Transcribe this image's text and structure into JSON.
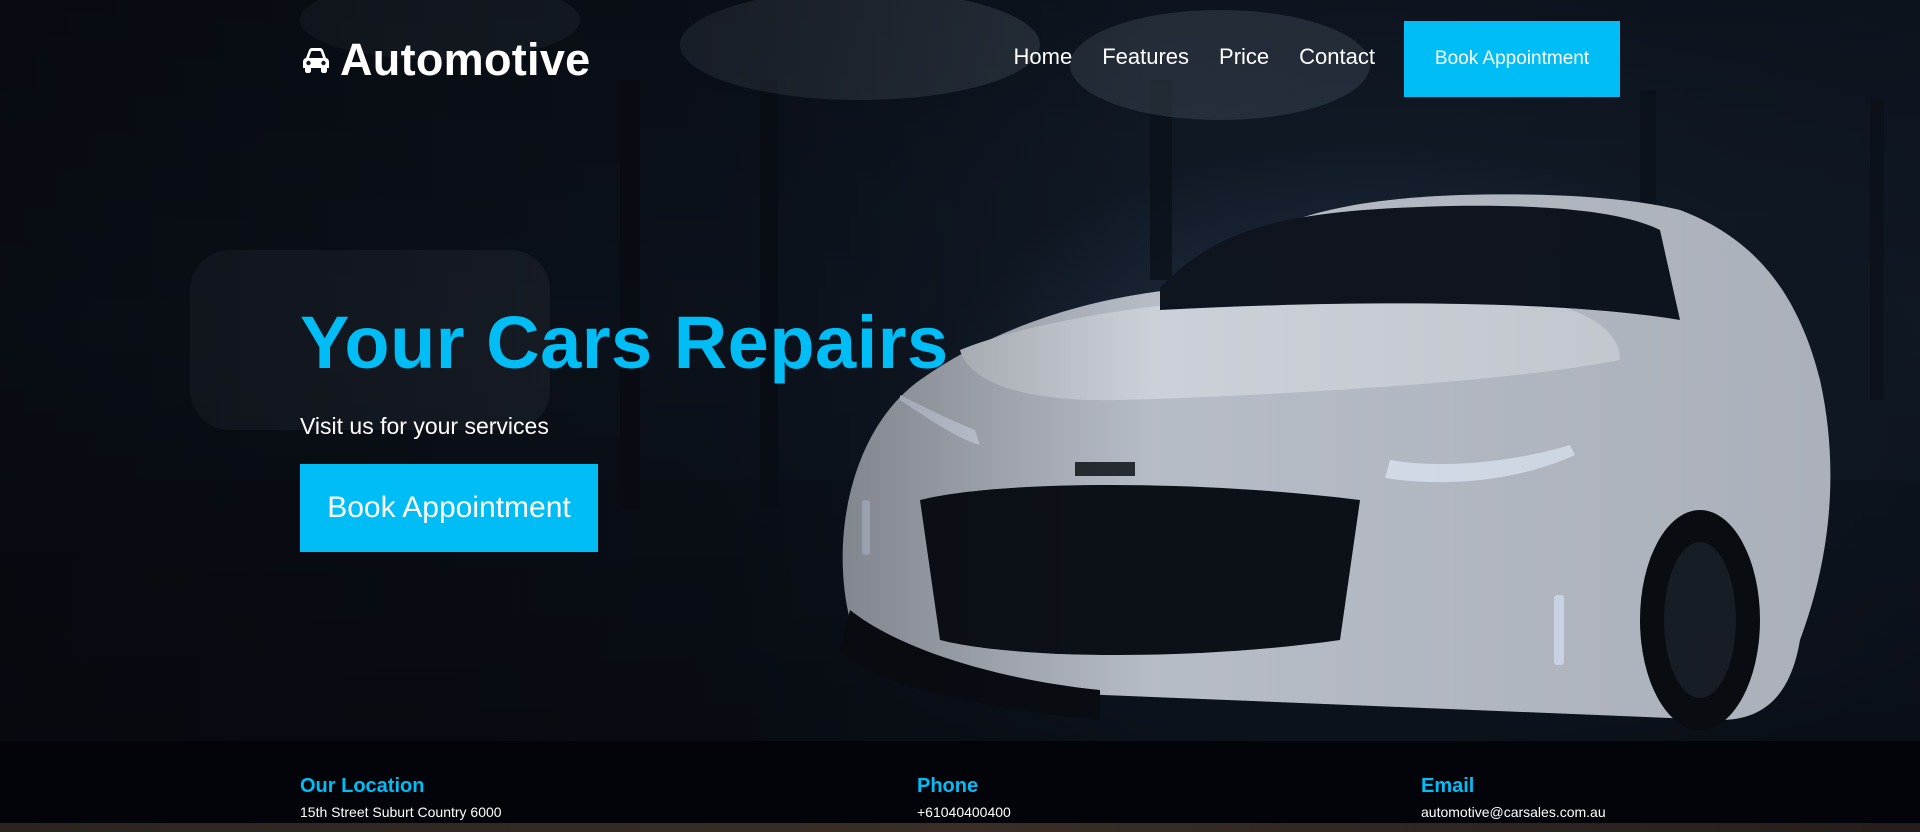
{
  "brand": {
    "name": "Automotive",
    "icon": "car-icon"
  },
  "nav": {
    "links": [
      "Home",
      "Features",
      "Price",
      "Contact"
    ],
    "cta": "Book Appointment"
  },
  "hero": {
    "title": "Your Cars Repairs",
    "subtitle": "Visit us for your services",
    "cta": "Book Appointment"
  },
  "contacts": [
    {
      "title": "Our Location",
      "value": "15th Street Suburt Country 6000"
    },
    {
      "title": "Phone",
      "value": "+61040400400"
    },
    {
      "title": "Email",
      "value": "automotive@carsales.com.au"
    }
  ],
  "colors": {
    "accent": "#00bdf5",
    "text": "#ffffff",
    "footer_bg": "#02040a"
  }
}
